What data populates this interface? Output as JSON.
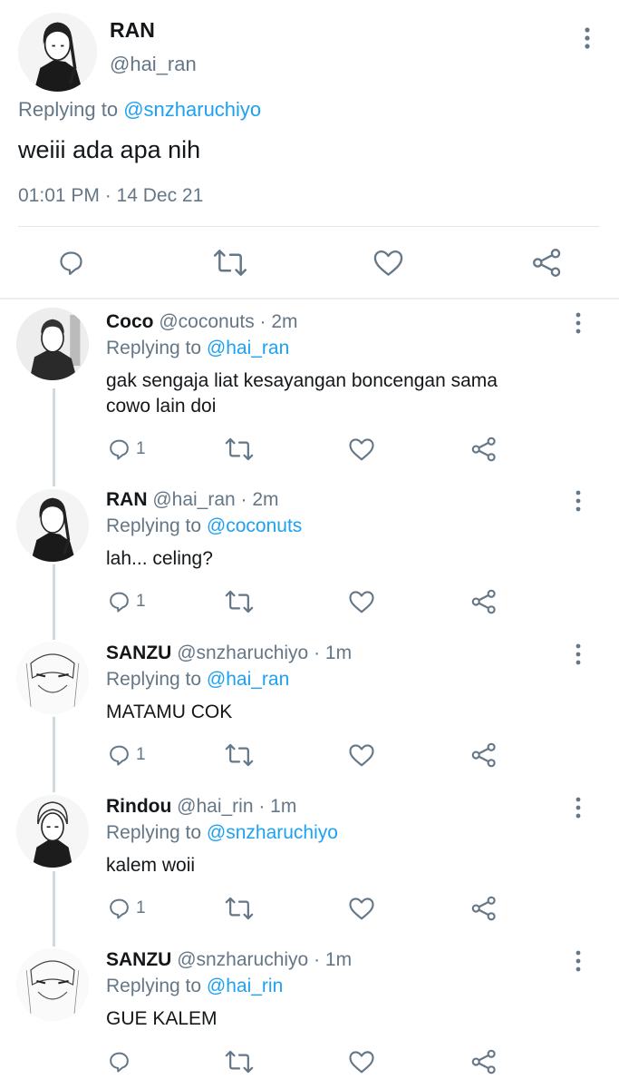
{
  "main": {
    "name": "RAN",
    "handle": "@hai_ran",
    "replying_label": "Replying to",
    "replying_to": "@snzharuchiyo",
    "text": "weiii ada apa nih",
    "timestamp": "01:01 PM · 14 Dec 21"
  },
  "replies": [
    {
      "name": "Coco",
      "meta": "@coconuts · 2m",
      "replying_label": "Replying to",
      "replying_to": "@hai_ran",
      "text_lines": [
        "gak sengaja liat kesayangan boncengan sama",
        "cowo lain doi"
      ],
      "reply_count": "1"
    },
    {
      "name": "RAN",
      "meta": "@hai_ran · 2m",
      "replying_label": "Replying to",
      "replying_to": "@coconuts",
      "text_lines": [
        "lah... celing?"
      ],
      "reply_count": "1"
    },
    {
      "name": "SANZU",
      "meta": "@snzharuchiyo · 1m",
      "replying_label": "Replying to",
      "replying_to": "@hai_ran",
      "text_lines": [
        "MATAMU COK"
      ],
      "reply_count": "1"
    },
    {
      "name": "Rindou",
      "meta": "@hai_rin · 1m",
      "replying_label": "Replying to",
      "replying_to": "@snzharuchiyo",
      "text_lines": [
        "kalem woii"
      ],
      "reply_count": "1"
    },
    {
      "name": "SANZU",
      "meta": "@snzharuchiyo · 1m",
      "replying_label": "Replying to",
      "replying_to": "@hai_rin",
      "text_lines": [
        "GUE KALEM"
      ],
      "reply_count": ""
    }
  ],
  "colors": {
    "accent": "#1da1f2",
    "muted": "#657786",
    "divider": "#e1e8ed"
  },
  "icons": [
    "more-icon",
    "reply-icon",
    "retweet-icon",
    "like-icon",
    "share-icon"
  ]
}
